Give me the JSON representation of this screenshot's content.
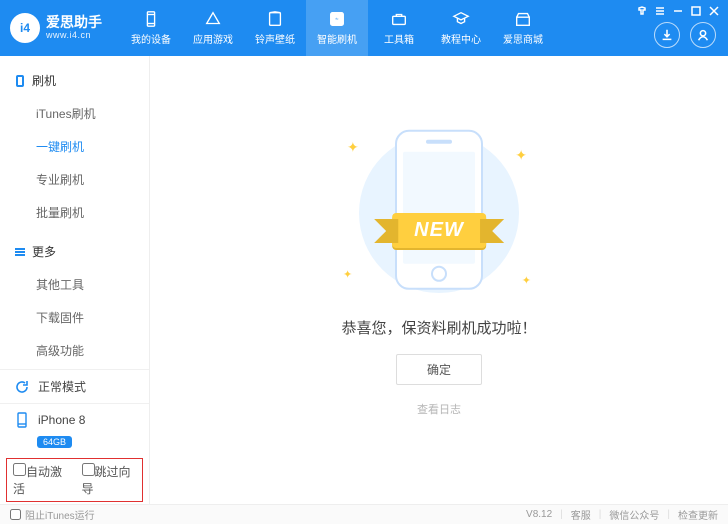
{
  "brand": {
    "name": "爱思助手",
    "site": "www.i4.cn",
    "logo_text": "i4"
  },
  "nav": [
    {
      "label": "我的设备"
    },
    {
      "label": "应用游戏"
    },
    {
      "label": "铃声壁纸"
    },
    {
      "label": "智能刷机"
    },
    {
      "label": "工具箱"
    },
    {
      "label": "教程中心"
    },
    {
      "label": "爱思商城"
    }
  ],
  "sidebar": {
    "sec_flash": "刷机",
    "flash_items": [
      "iTunes刷机",
      "一键刷机",
      "专业刷机",
      "批量刷机"
    ],
    "sec_more": "更多",
    "more_items": [
      "其他工具",
      "下载固件",
      "高级功能"
    ],
    "mode_label": "正常模式",
    "device_name": "iPhone 8",
    "device_capacity": "64GB",
    "chk_auto_activate": "自动激活",
    "chk_skip_guide": "跳过向导"
  },
  "main": {
    "illus_badge": "NEW",
    "message": "恭喜您，保资料刷机成功啦！",
    "ok_button": "确定",
    "view_log": "查看日志"
  },
  "footer": {
    "block_itunes": "阻止iTunes运行",
    "version": "V8.12",
    "support": "客服",
    "wechat": "微信公众号",
    "update": "检查更新"
  }
}
